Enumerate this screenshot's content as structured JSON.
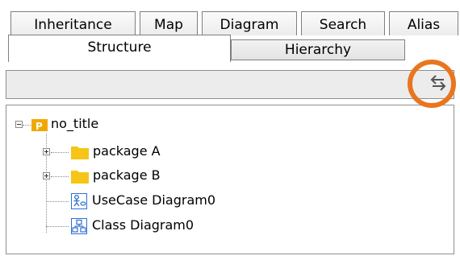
{
  "tabs_row1": [
    "Inheritance",
    "Map",
    "Diagram",
    "Search",
    "Alias"
  ],
  "tabs_row2": {
    "active": "Structure",
    "inactive": "Hierarchy"
  },
  "toolbar": {
    "swap_icon": "swap-arrows-icon",
    "highlight_color": "#e9761e"
  },
  "tree": {
    "root": {
      "label": "no_title",
      "icon": "project-icon"
    },
    "children": [
      {
        "label": "package A",
        "icon": "folder-icon",
        "expandable": true
      },
      {
        "label": "package B",
        "icon": "folder-icon",
        "expandable": true
      },
      {
        "label": "UseCase Diagram0",
        "icon": "usecase-diagram-icon",
        "expandable": false
      },
      {
        "label": "Class Diagram0",
        "icon": "class-diagram-icon",
        "expandable": false
      }
    ]
  },
  "colors": {
    "folder": "#f5c518",
    "project_badge": "#f0a800",
    "diagram_icon": "#2f6fd1"
  }
}
